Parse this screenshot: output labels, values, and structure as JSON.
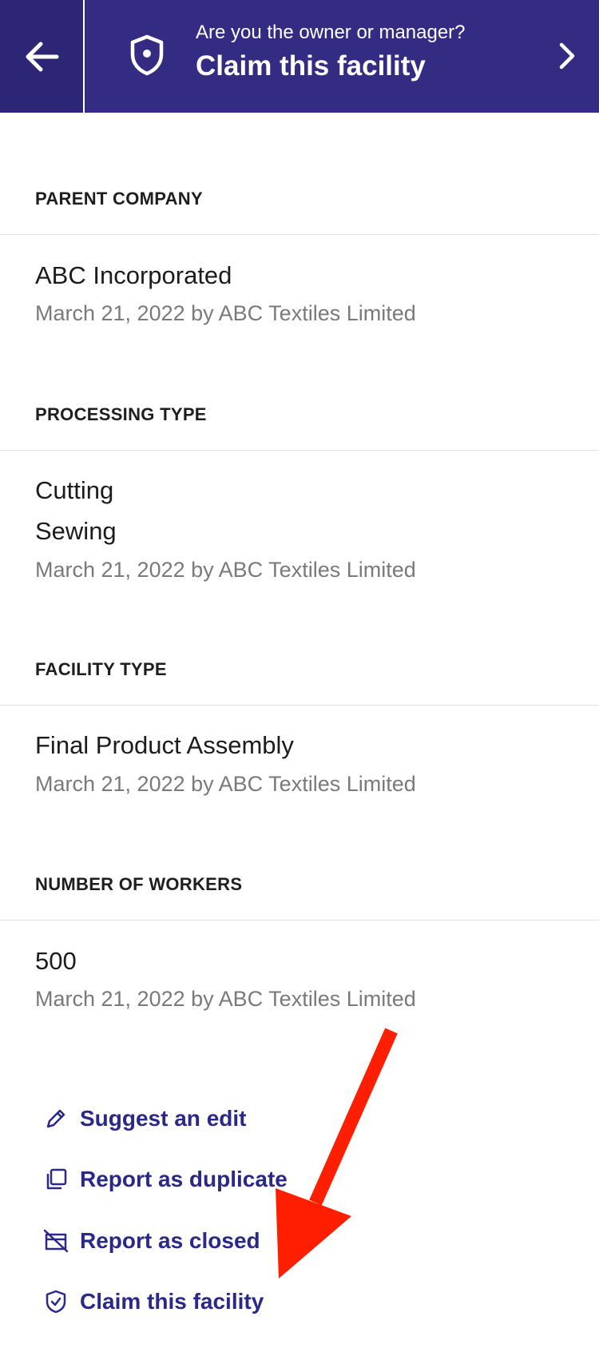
{
  "banner": {
    "back_icon": "arrow-left-icon",
    "shield_icon": "shield-icon",
    "subtitle": "Are you the owner or manager?",
    "title": "Claim this facility",
    "chevron_icon": "chevron-right-icon",
    "bg_color": "#342c82"
  },
  "sections": [
    {
      "label": "PARENT COMPANY",
      "values": [
        "ABC Incorporated"
      ],
      "meta": "March 21, 2022 by ABC Textiles Limited"
    },
    {
      "label": "PROCESSING TYPE",
      "values": [
        "Cutting",
        "Sewing"
      ],
      "meta": "March 21, 2022 by ABC Textiles Limited"
    },
    {
      "label": "FACILITY TYPE",
      "values": [
        "Final Product Assembly"
      ],
      "meta": "March 21, 2022 by ABC Textiles Limited"
    },
    {
      "label": "NUMBER OF WORKERS",
      "values": [
        "500"
      ],
      "meta": "March 21, 2022 by ABC Textiles Limited"
    }
  ],
  "actions": [
    {
      "icon": "pencil-icon",
      "label": "Suggest an edit"
    },
    {
      "icon": "duplicate-icon",
      "label": "Report as duplicate"
    },
    {
      "icon": "closed-store-icon",
      "label": "Report as closed"
    },
    {
      "icon": "shield-check-icon",
      "label": "Claim this facility"
    }
  ],
  "annotation": {
    "arrow_color": "#ff1e00"
  },
  "link_color": "#2a2888"
}
